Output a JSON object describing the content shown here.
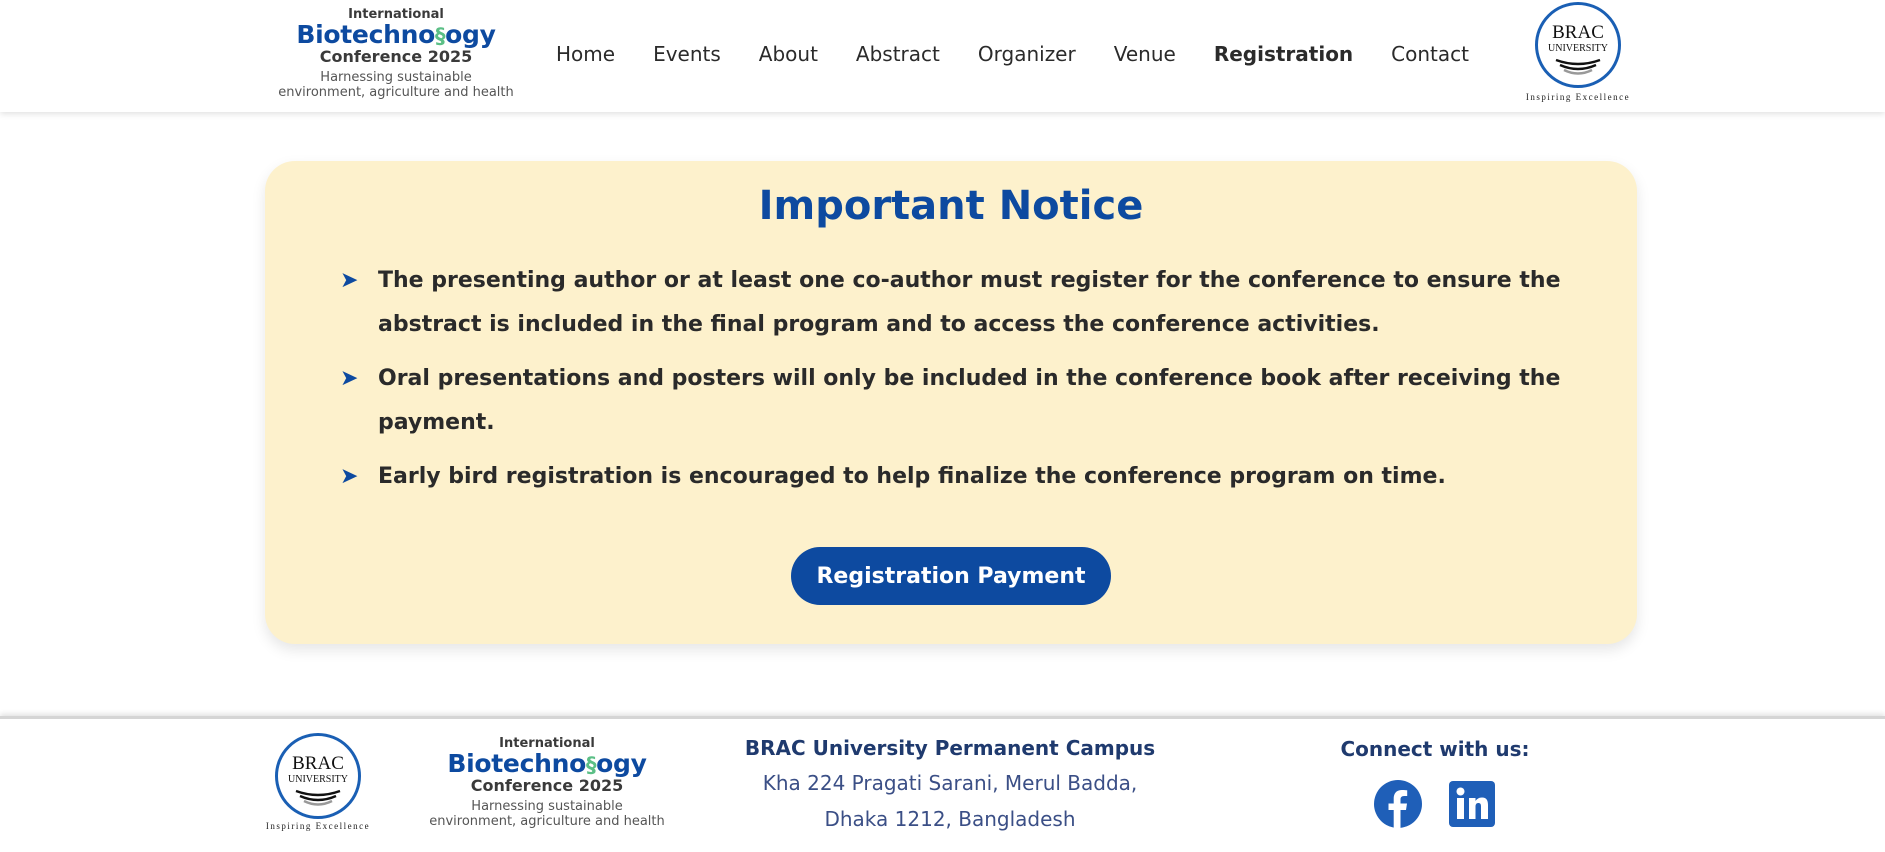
{
  "header": {
    "conference_logo": {
      "line1": "International",
      "line2_prefix": "Biotechno",
      "line2_dna": "§",
      "line2_suffix": "ogy",
      "line3": "Conference 2025",
      "tagline_1": "Harnessing sustainable",
      "tagline_2": "environment, agriculture and health"
    },
    "nav": {
      "items": [
        "Home",
        "Events",
        "About",
        "Abstract",
        "Organizer",
        "Venue",
        "Registration",
        "Contact"
      ],
      "active": "Registration"
    },
    "university_logo": {
      "word1": "BRAC",
      "word2": "UNIVERSITY",
      "tagline": "Inspiring Excellence"
    }
  },
  "notice": {
    "title": "Important Notice",
    "bullet_icon": "arrow-right-icon",
    "items": [
      "The presenting author or at least one co-author must register for the conference to ensure the abstract is included in the final program and to access the conference activities.",
      "Oral presentations and posters will only be included in the conference book after receiving the payment.",
      "Early bird registration is encouraged to help finalize the conference program on time."
    ],
    "button_label": "Registration Payment"
  },
  "footer": {
    "campus_title": "BRAC University Permanent Campus",
    "address_line1": "Kha 224 Pragati Sarani, Merul Badda,",
    "address_line2": "Dhaka 1212, Bangladesh",
    "connect_title": "Connect with us:",
    "socials": [
      "facebook-icon",
      "linkedin-icon"
    ]
  },
  "colors": {
    "brand_blue": "#0d4aa0",
    "notice_bg": "#fdf1cc",
    "footer_text": "#1f3a6e"
  }
}
